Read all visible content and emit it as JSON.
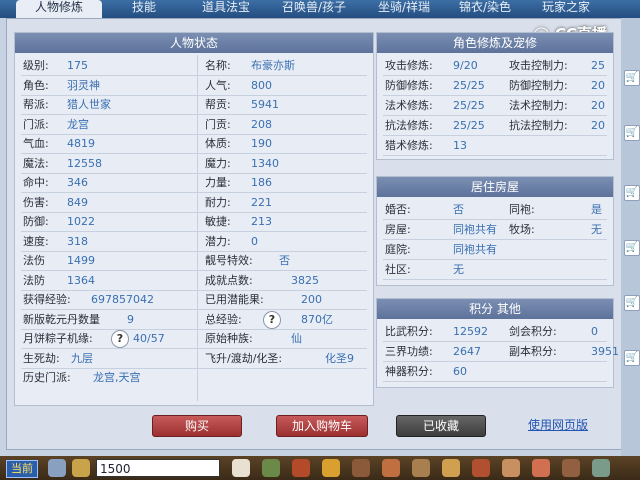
{
  "tabs": [
    "人物修炼",
    "技能",
    "道具法宝",
    "召唤兽/孩子",
    "坐骑/祥瑞",
    "锦衣/染色",
    "玩家之家"
  ],
  "brand": "CC直播",
  "status_panel": {
    "title": "人物状态",
    "left": [
      {
        "label": "级别:",
        "value": "175"
      },
      {
        "label": "角色:",
        "value": "羽灵神"
      },
      {
        "label": "帮派:",
        "value": "猎人世家"
      },
      {
        "label": "门派:",
        "value": "龙宫"
      },
      {
        "label": "气血:",
        "value": "4819"
      },
      {
        "label": "魔法:",
        "value": "12558"
      },
      {
        "label": "命中:",
        "value": "346"
      },
      {
        "label": "伤害:",
        "value": "849"
      },
      {
        "label": "防御:",
        "value": "1022"
      },
      {
        "label": "速度:",
        "value": "318"
      },
      {
        "label": "法伤",
        "value": "1499"
      },
      {
        "label": "法防",
        "value": "1364"
      },
      {
        "label": "获得经验:",
        "value": "697857042"
      },
      {
        "label": "新版乾元丹数量",
        "value": "9"
      },
      {
        "label": "月饼粽子机缘:",
        "value": "40/57"
      },
      {
        "label": "生死劫:",
        "value": "九层"
      }
    ],
    "right": [
      {
        "label": "名称:",
        "value": "布豪亦斯"
      },
      {
        "label": "人气:",
        "value": "800"
      },
      {
        "label": "帮贡:",
        "value": "5941"
      },
      {
        "label": "门贡:",
        "value": "208"
      },
      {
        "label": "体质:",
        "value": "190"
      },
      {
        "label": "魔力:",
        "value": "1340"
      },
      {
        "label": "力量:",
        "value": "186"
      },
      {
        "label": "耐力:",
        "value": "221"
      },
      {
        "label": "敏捷:",
        "value": "213"
      },
      {
        "label": "潜力:",
        "value": "0"
      },
      {
        "label": "靓号特效:",
        "value": "否"
      },
      {
        "label": "成就点数:",
        "value": "3825"
      },
      {
        "label": "已用潜能果:",
        "value": "200"
      },
      {
        "label": "总经验:",
        "value": "870亿"
      },
      {
        "label": "原始种族:",
        "value": "仙"
      },
      {
        "label": "飞升/渡劫/化圣:",
        "value": "化圣9"
      }
    ],
    "history_label": "历史门派:",
    "history_value": "龙宫,天宫",
    "help_glyph": "?"
  },
  "cultivation_panel": {
    "title": "角色修炼及宠修",
    "rows": [
      {
        "l1": "攻击修炼:",
        "v1": "9/20",
        "l2": "攻击控制力:",
        "v2": "25"
      },
      {
        "l1": "防御修炼:",
        "v1": "25/25",
        "l2": "防御控制力:",
        "v2": "20"
      },
      {
        "l1": "法术修炼:",
        "v1": "25/25",
        "l2": "法术控制力:",
        "v2": "20"
      },
      {
        "l1": "抗法修炼:",
        "v1": "25/25",
        "l2": "抗法控制力:",
        "v2": "20"
      },
      {
        "l1": "猎术修炼:",
        "v1": "13",
        "l2": "",
        "v2": ""
      }
    ]
  },
  "house_panel": {
    "title": "居住房屋",
    "rows": [
      {
        "l1": "婚否:",
        "v1": "否",
        "l2": "同袍:",
        "v2": "是"
      },
      {
        "l1": "房屋:",
        "v1": "同袍共有",
        "l2": "牧场:",
        "v2": "无"
      },
      {
        "l1": "庭院:",
        "v1": "同袍共有",
        "l2": "",
        "v2": ""
      },
      {
        "l1": "社区:",
        "v1": "无",
        "l2": "",
        "v2": ""
      }
    ]
  },
  "score_panel": {
    "title": "积分 其他",
    "rows": [
      {
        "l1": "比武积分:",
        "v1": "12592",
        "l2": "剑会积分:",
        "v2": "0"
      },
      {
        "l1": "三界功绩:",
        "v1": "2647",
        "l2": "副本积分:",
        "v2": "3951"
      },
      {
        "l1": "神器积分:",
        "v1": "60",
        "l2": "",
        "v2": ""
      }
    ]
  },
  "buttons": {
    "buy": "购买",
    "add_cart": "加入购物车",
    "collected": "已收藏",
    "web": "使用网页版"
  },
  "bottom": {
    "current": "当前",
    "input_value": "1500"
  },
  "colors": {
    "value": "#3a6fb0",
    "header": "#6a7fa6",
    "buy_red": "#a83a3a"
  }
}
